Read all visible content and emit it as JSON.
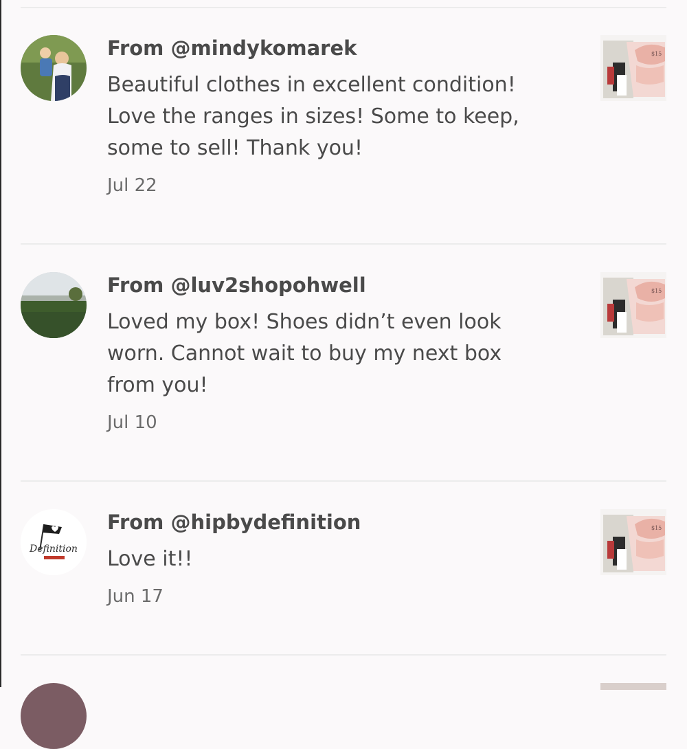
{
  "reviews": [
    {
      "from": "From @mindykomarek",
      "comment": "Beautiful clothes in excellent condition!\nLove the ranges in sizes! Some to keep,\nsome to sell! Thank you!",
      "date": "Jul 22",
      "avatar_icon": "photo-avatar",
      "thumb_icon": "listing-photo"
    },
    {
      "from": "From @luv2shopohwell",
      "comment": "Loved my box! Shoes didn’t even look\nworn. Cannot wait to buy my next box\nfrom you!",
      "date": "Jul 10",
      "avatar_icon": "landscape-avatar",
      "thumb_icon": "listing-photo"
    },
    {
      "from": "From @hipbydefinition",
      "comment": "Love it!!",
      "date": "Jun 17",
      "avatar_icon": "logo-avatar",
      "thumb_icon": "listing-photo"
    }
  ],
  "colors": {
    "background": "#fbf9fa",
    "text": "#4a4a4a",
    "muted": "#6b6b6b",
    "divider": "#ececec"
  }
}
